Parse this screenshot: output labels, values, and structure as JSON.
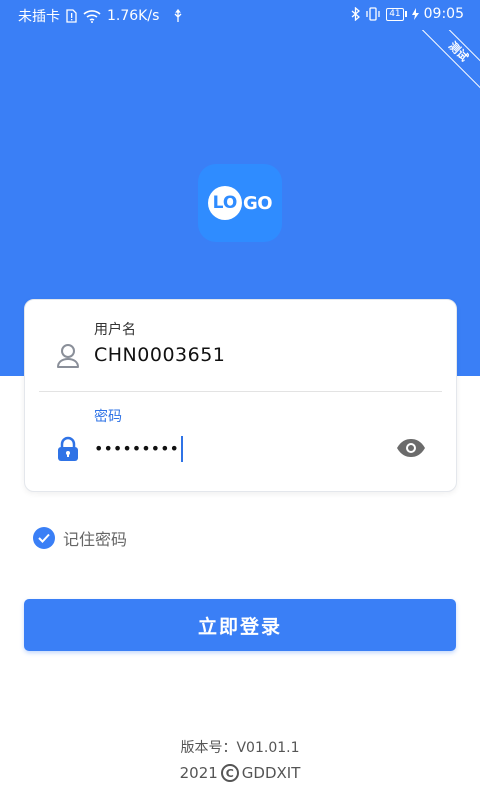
{
  "status_bar": {
    "carrier": "未插卡",
    "speed": "1.76K/s",
    "battery": "41",
    "time": "09:05",
    "icons": [
      "sim-alert-icon",
      "wifi-icon",
      "usb-icon",
      "bluetooth-icon",
      "vibrate-icon",
      "battery-icon",
      "charging-icon"
    ]
  },
  "ribbon": {
    "label": "测试"
  },
  "logo": {
    "circle_text": "LO",
    "text": "GO"
  },
  "form": {
    "username_label": "用户名",
    "username_value": "CHN0003651",
    "password_label": "密码",
    "password_masked": "•••••••••",
    "user_icon": "person-icon",
    "lock_icon": "lock-icon",
    "eye_icon": "eye-icon"
  },
  "remember": {
    "label": "记住密码",
    "checked": true
  },
  "login_button": {
    "label": "立即登录"
  },
  "footer": {
    "version": "版本号：V01.01.1",
    "year": "2021",
    "copyright_symbol": "C",
    "company": "GDDXIT"
  },
  "colors": {
    "primary": "#3a7ff6",
    "logo_bg": "#2f8cff",
    "active_label": "#2f73e6"
  }
}
